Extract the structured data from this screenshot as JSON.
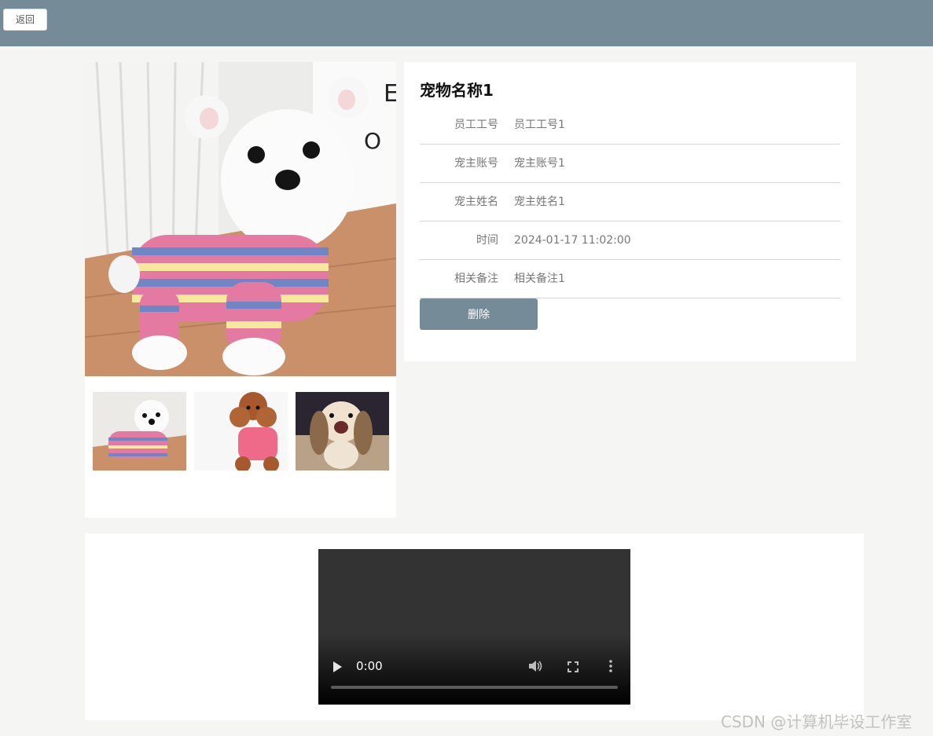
{
  "header": {
    "back_label": "返回",
    "bar_color": "#758b98"
  },
  "detail": {
    "title": "宠物名称1",
    "fields": [
      {
        "label": "员工工号",
        "value": "员工工号1"
      },
      {
        "label": "宠主账号",
        "value": "宠主账号1"
      },
      {
        "label": "宠主姓名",
        "value": "宠主姓名1"
      },
      {
        "label": "时间",
        "value": "2024-01-17 11:02:00"
      },
      {
        "label": "相关备注",
        "value": "相关备注1"
      }
    ],
    "delete_label": "删除"
  },
  "gallery": {
    "main_icon": "white-puppy-in-striped-sweater-photo",
    "thumbs": [
      {
        "icon": "white-puppy-in-striped-sweater-photo"
      },
      {
        "icon": "brown-poodle-in-pink-hoodie-photo"
      },
      {
        "icon": "long-haired-dog-photo"
      }
    ]
  },
  "video": {
    "time": "0:00"
  },
  "watermark": "CSDN @计算机毕设工作室"
}
